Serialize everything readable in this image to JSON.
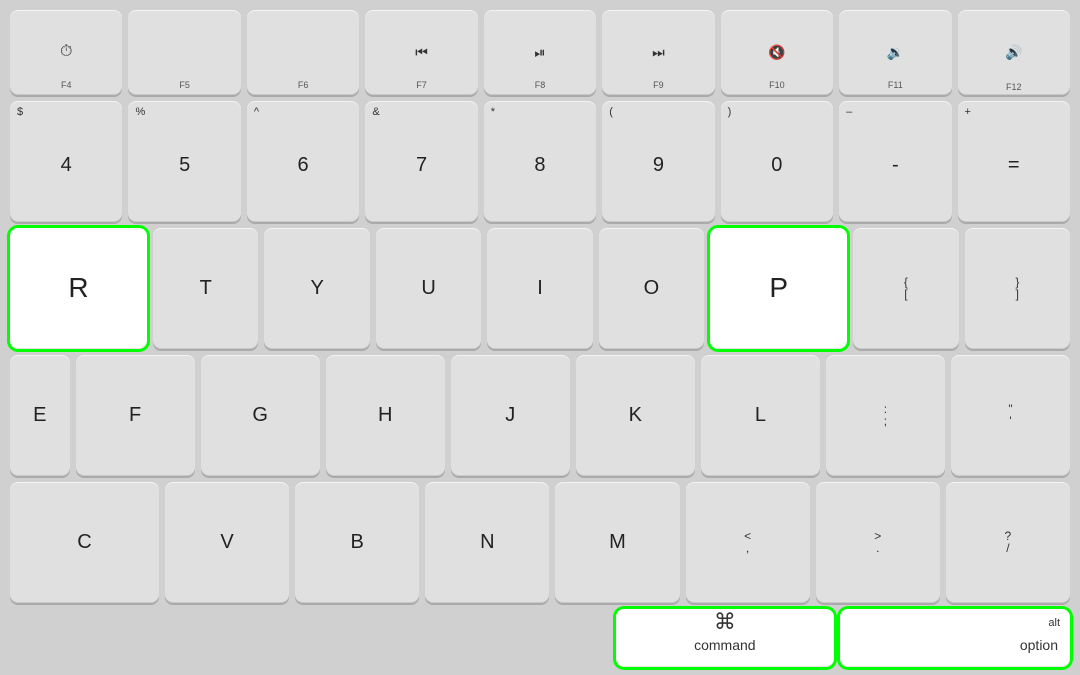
{
  "keyboard": {
    "bg_color": "#d0d0d0",
    "key_color": "#e0e0e0",
    "key_highlight_color": "#ffffff",
    "highlight_border": "#00ff00",
    "rows": {
      "fn_row": [
        {
          "id": "f4",
          "top": "",
          "main": "",
          "icon": "gauge",
          "fn": "F4",
          "wide": 1
        },
        {
          "id": "f5",
          "top": "",
          "main": "",
          "fn": "F5",
          "wide": 1
        },
        {
          "id": "f6",
          "top": "",
          "main": "",
          "fn": "F6",
          "wide": 1
        },
        {
          "id": "f7",
          "top": "",
          "main": "◀◀",
          "fn": "F7",
          "wide": 1
        },
        {
          "id": "f8",
          "top": "",
          "main": "▶‖",
          "fn": "F8",
          "wide": 1
        },
        {
          "id": "f9",
          "top": "",
          "main": "▶▶",
          "fn": "F9",
          "wide": 1
        },
        {
          "id": "f10",
          "top": "",
          "main": "◀",
          "fn": "F10",
          "wide": 1
        },
        {
          "id": "f11",
          "top": "",
          "main": "◀)",
          "fn": "F11",
          "wide": 1
        },
        {
          "id": "f12",
          "top": "",
          "main": "◀))",
          "fn": "F12",
          "wide": 1
        }
      ],
      "number_row": [
        {
          "id": "4",
          "top": "$",
          "main": "4"
        },
        {
          "id": "5",
          "top": "%",
          "main": "5"
        },
        {
          "id": "6",
          "top": "^",
          "main": "6"
        },
        {
          "id": "7",
          "top": "&",
          "main": "7"
        },
        {
          "id": "8",
          "top": "*",
          "main": "8"
        },
        {
          "id": "9",
          "top": "(",
          "main": "9"
        },
        {
          "id": "0",
          "top": ")",
          "main": "0"
        },
        {
          "id": "minus",
          "top": "–",
          "main": "-"
        },
        {
          "id": "equals",
          "top": "+",
          "main": "="
        }
      ],
      "qwerty_row": [
        {
          "id": "r",
          "top": "",
          "main": "R",
          "highlighted": true
        },
        {
          "id": "t",
          "top": "",
          "main": "T"
        },
        {
          "id": "y",
          "top": "",
          "main": "Y"
        },
        {
          "id": "u",
          "top": "",
          "main": "U"
        },
        {
          "id": "i",
          "top": "",
          "main": "I"
        },
        {
          "id": "o",
          "top": "",
          "main": "O"
        },
        {
          "id": "p",
          "top": "",
          "main": "P",
          "highlighted": true
        },
        {
          "id": "brace_open",
          "top": "{",
          "main": "["
        },
        {
          "id": "brace_close",
          "top": "}",
          "main": "]"
        }
      ],
      "home_row": [
        {
          "id": "e_partial",
          "top": "",
          "main": "E",
          "wide": "partial"
        },
        {
          "id": "f",
          "top": "",
          "main": "F"
        },
        {
          "id": "g",
          "top": "",
          "main": "G"
        },
        {
          "id": "h",
          "top": "",
          "main": "H"
        },
        {
          "id": "j",
          "top": "",
          "main": "J"
        },
        {
          "id": "k",
          "top": "",
          "main": "K"
        },
        {
          "id": "l",
          "top": "",
          "main": "L"
        },
        {
          "id": "semicolon",
          "top": ":",
          "main": ";"
        },
        {
          "id": "quote",
          "top": "\"",
          "main": "'"
        }
      ],
      "bottom_row": [
        {
          "id": "c",
          "top": "",
          "main": "C"
        },
        {
          "id": "v",
          "top": "",
          "main": "V"
        },
        {
          "id": "b",
          "top": "",
          "main": "B"
        },
        {
          "id": "n",
          "top": "",
          "main": "N"
        },
        {
          "id": "m",
          "top": "",
          "main": "M"
        },
        {
          "id": "comma",
          "top": "<",
          "main": ","
        },
        {
          "id": "period",
          "top": ">",
          "main": "."
        },
        {
          "id": "slash",
          "top": "?",
          "main": "/"
        }
      ],
      "modifier_row": [
        {
          "id": "command",
          "main": "command",
          "icon": "⌘",
          "highlighted": true
        },
        {
          "id": "option",
          "main": "option",
          "top_right": "alt",
          "highlighted": true
        }
      ]
    }
  }
}
